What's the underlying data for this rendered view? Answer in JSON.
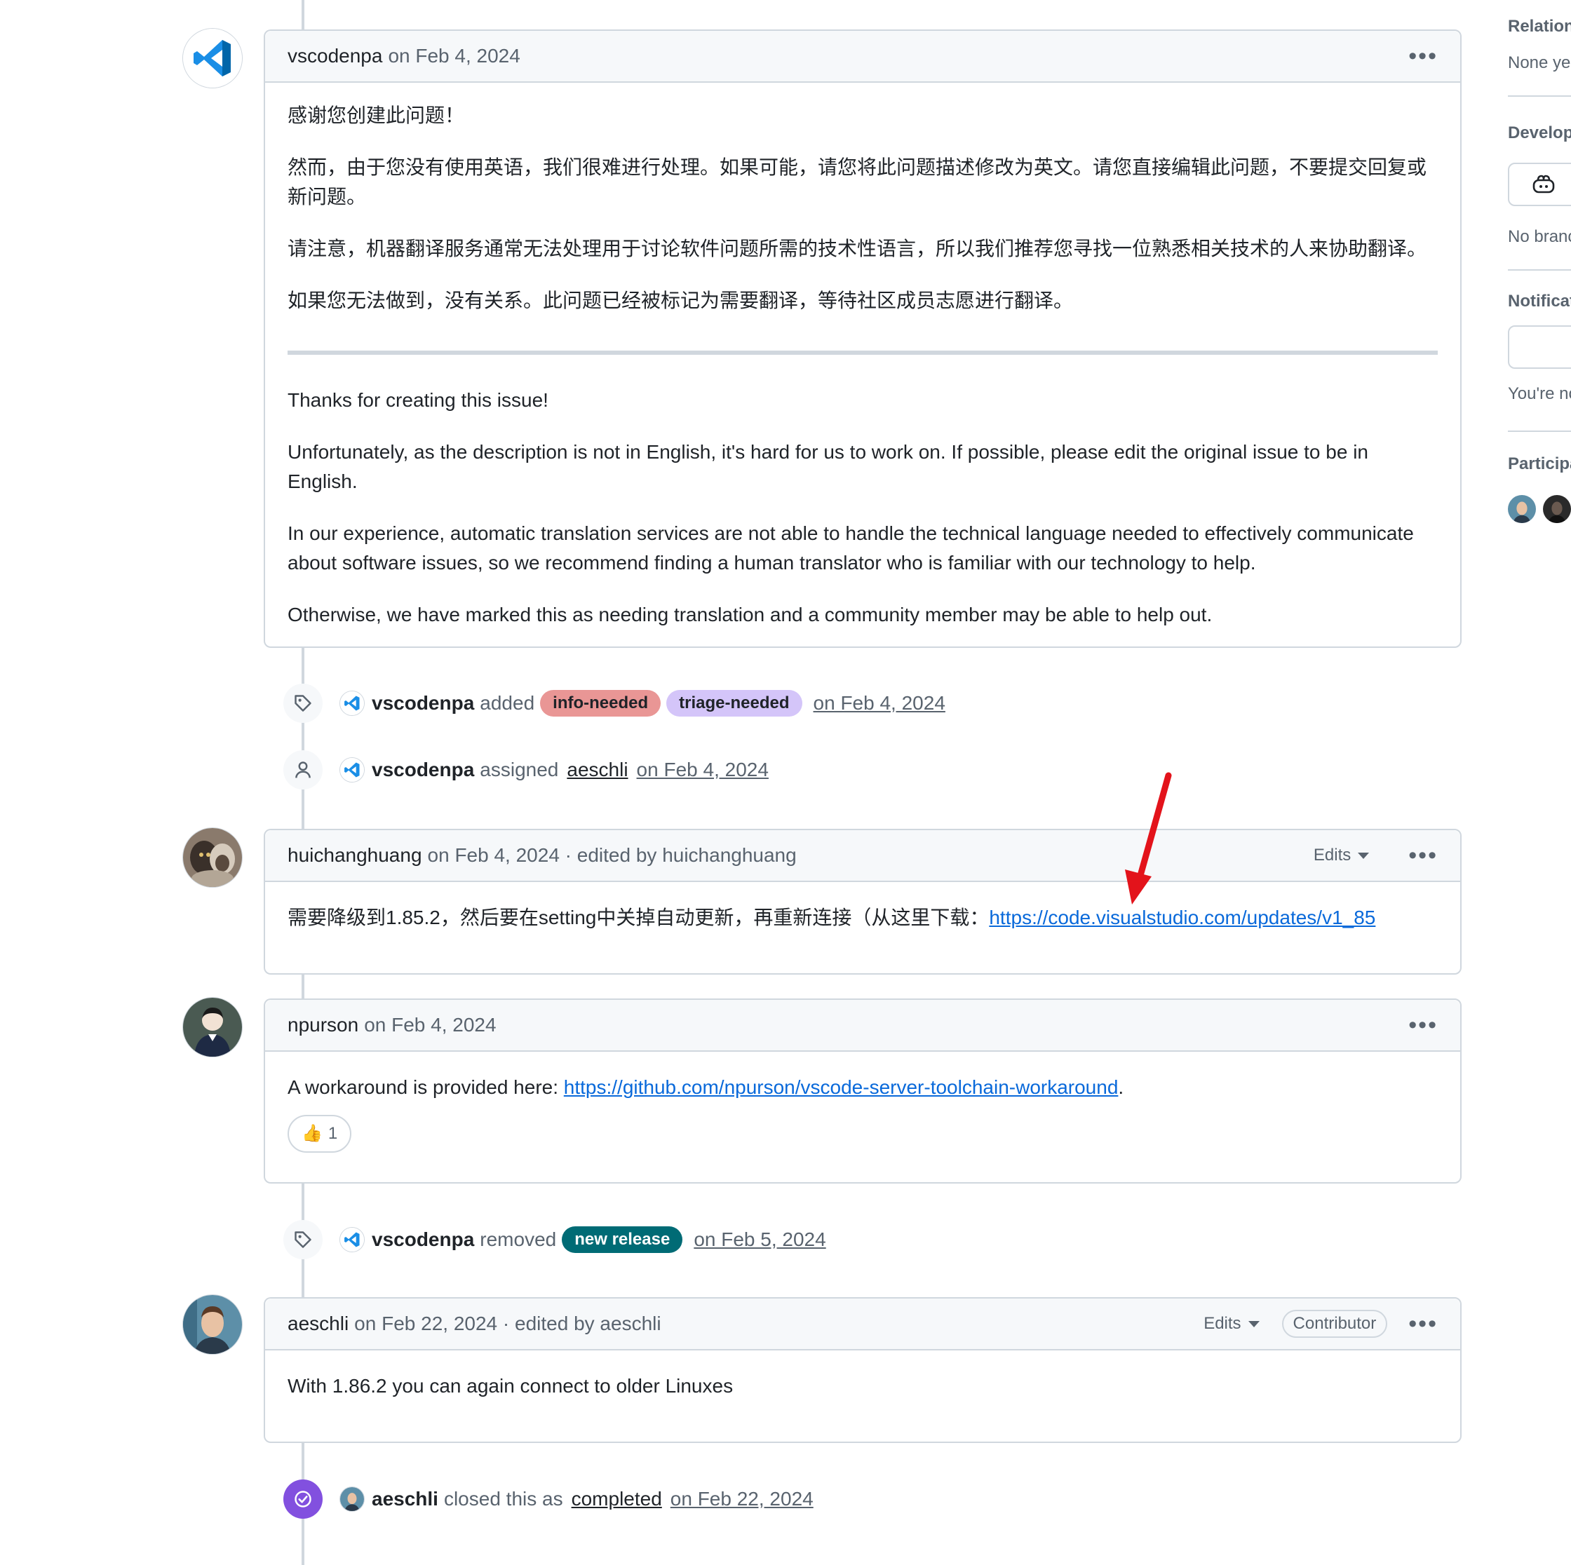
{
  "comments": [
    {
      "author": "vscodenpa",
      "meta": "on Feb 4, 2024",
      "paragraphs_zh": [
        "感谢您创建此问题！",
        "然而，由于您没有使用英语，我们很难进行处理。如果可能，请您将此问题描述修改为英文。请您直接编辑此问题，不要提交回复或新问题。",
        "请注意，机器翻译服务通常无法处理用于讨论软件问题所需的技术性语言，所以我们推荐您寻找一位熟悉相关技术的人来协助翻译。",
        "如果您无法做到，没有关系。此问题已经被标记为需要翻译，等待社区成员志愿进行翻译。"
      ],
      "paragraphs_en": [
        "Thanks for creating this issue!",
        "Unfortunately, as the description is not in English, it's hard for us to work on. If possible, please edit the original issue to be in English.",
        "In our experience, automatic translation services are not able to handle the technical language needed to effectively communicate about software issues, so we recommend finding a human translator who is familiar with our technology to help.",
        "Otherwise, we have marked this as needing translation and a community member may be able to help out."
      ]
    },
    {
      "author": "huichanghuang",
      "meta": "on Feb 4, 2024 · edited by huichanghuang",
      "edits_label": "Edits",
      "body_text": "需要降级到1.85.2，然后要在setting中关掉自动更新，再重新连接（从这里下载：",
      "body_link": "https://code.visualstudio.com/updates/v1_85"
    },
    {
      "author": "npurson",
      "meta": "on Feb 4, 2024",
      "body_text": "A workaround is provided here: ",
      "body_link": "https://github.com/npurson/vscode-server-toolchain-workaround",
      "body_suffix": ".",
      "reaction_emoji": "👍",
      "reaction_count": "1"
    },
    {
      "author": "aeschli",
      "meta": "on Feb 22, 2024 · edited by aeschli",
      "edits_label": "Edits",
      "role": "Contributor",
      "body_text": "With 1.86.2 you can again connect to older Linuxes"
    }
  ],
  "events": [
    {
      "actor": "vscodenpa",
      "verb": "added",
      "labels": [
        {
          "name": "info-needed",
          "bg": "#e99695",
          "fg": "#1f2328"
        },
        {
          "name": "triage-needed",
          "bg": "#d4c5f9",
          "fg": "#1f2328"
        }
      ],
      "date": "on Feb 4, 2024"
    },
    {
      "actor": "vscodenpa",
      "verb": "assigned",
      "target": "aeschli",
      "date": "on Feb 4, 2024"
    },
    {
      "actor": "vscodenpa",
      "verb": "removed",
      "labels": [
        {
          "name": "new release",
          "bg": "#006b75",
          "fg": "#ffffff"
        }
      ],
      "date": "on Feb 5, 2024"
    },
    {
      "actor": "aeschli",
      "verb": "closed this as",
      "target": "completed",
      "date": "on Feb 22, 2024"
    }
  ],
  "sidebar": {
    "relationships_title": "Relation",
    "relationships_value": "None ye",
    "development_title": "Develop",
    "development_value": "No branc",
    "notifications_title": "Notificat",
    "notifications_value": "You're no",
    "participants_title": "Participa"
  },
  "icons": {
    "kebab": "kebab-horizontal-icon",
    "tag": "tag-icon",
    "person": "person-icon",
    "closed": "check-circle-icon",
    "copilot": "copilot-icon"
  },
  "colors": {
    "border": "#d0d7de",
    "link": "#0969da",
    "muted": "#59636e",
    "closed_purple": "#8250df",
    "vscode_blue": "#0078d4",
    "annotation_arrow": "#e3131b"
  }
}
